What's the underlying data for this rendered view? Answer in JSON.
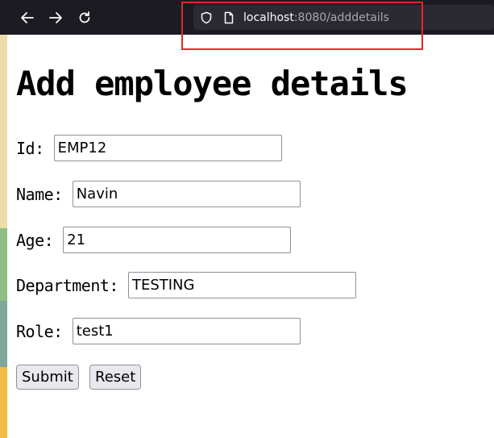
{
  "browser": {
    "url_host": "localhost",
    "url_rest": ":8080/adddetails",
    "icons": [
      "back-arrow-icon",
      "forward-arrow-icon",
      "reload-icon",
      "shield-icon",
      "page-icon"
    ],
    "colors": {
      "toolbar": "#1c1b22",
      "urlbar": "#2b2a33",
      "highlight": "#e8242c"
    }
  },
  "page": {
    "title": "Add employee details"
  },
  "form": {
    "fields": [
      {
        "label": "Id:",
        "value": "EMP12"
      },
      {
        "label": "Name:",
        "value": "Navin"
      },
      {
        "label": "Age:",
        "value": "21"
      },
      {
        "label": "Department:",
        "value": "TESTING"
      },
      {
        "label": "Role:",
        "value": "test1"
      }
    ],
    "submit_label": "Submit",
    "reset_label": "Reset"
  }
}
